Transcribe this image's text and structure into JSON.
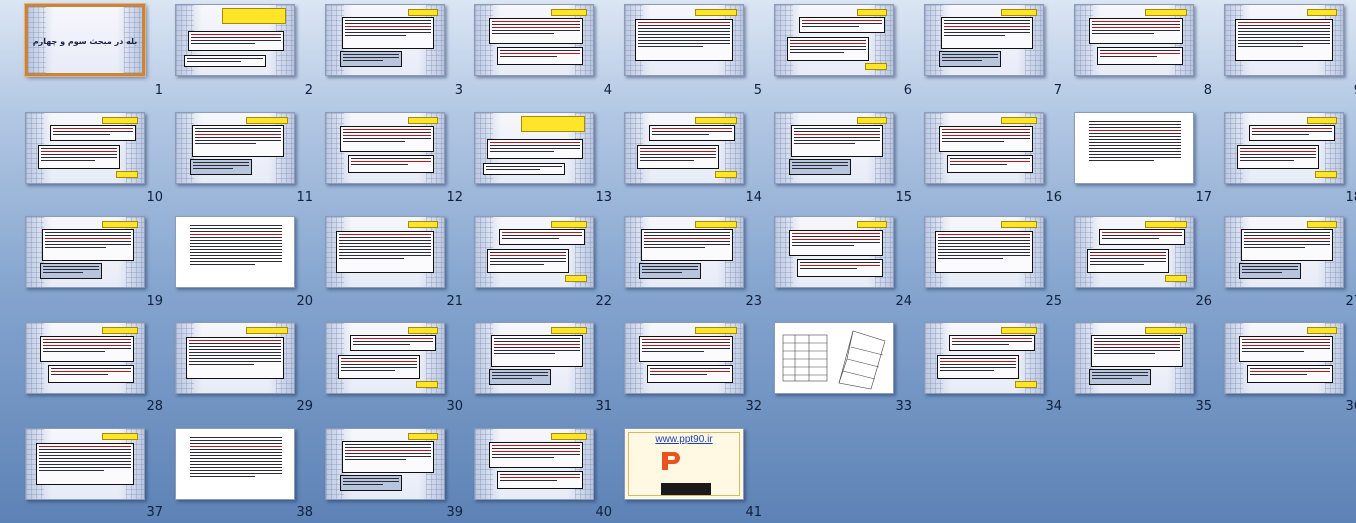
{
  "slide_sorter": {
    "selected_slide": 1,
    "slides": [
      {
        "number": "1",
        "layout": "title",
        "title": "بله در مبحث سوم و چهارم"
      },
      {
        "number": "2",
        "layout": "title-box-yellow"
      },
      {
        "number": "3",
        "layout": "text"
      },
      {
        "number": "4",
        "layout": "text"
      },
      {
        "number": "5",
        "layout": "text"
      },
      {
        "number": "6",
        "layout": "text"
      },
      {
        "number": "7",
        "layout": "text"
      },
      {
        "number": "8",
        "layout": "text"
      },
      {
        "number": "9",
        "layout": "text"
      },
      {
        "number": "10",
        "layout": "text"
      },
      {
        "number": "11",
        "layout": "text"
      },
      {
        "number": "12",
        "layout": "text"
      },
      {
        "number": "13",
        "layout": "title-box-yellow"
      },
      {
        "number": "14",
        "layout": "text"
      },
      {
        "number": "15",
        "layout": "text"
      },
      {
        "number": "16",
        "layout": "text"
      },
      {
        "number": "17",
        "layout": "text-plain"
      },
      {
        "number": "18",
        "layout": "text"
      },
      {
        "number": "19",
        "layout": "text"
      },
      {
        "number": "20",
        "layout": "text-plain"
      },
      {
        "number": "21",
        "layout": "text"
      },
      {
        "number": "22",
        "layout": "text"
      },
      {
        "number": "23",
        "layout": "text"
      },
      {
        "number": "24",
        "layout": "text"
      },
      {
        "number": "25",
        "layout": "text"
      },
      {
        "number": "26",
        "layout": "text"
      },
      {
        "number": "27",
        "layout": "text"
      },
      {
        "number": "28",
        "layout": "text"
      },
      {
        "number": "29",
        "layout": "text"
      },
      {
        "number": "30",
        "layout": "text"
      },
      {
        "number": "31",
        "layout": "text"
      },
      {
        "number": "32",
        "layout": "text"
      },
      {
        "number": "33",
        "layout": "diagram"
      },
      {
        "number": "34",
        "layout": "text"
      },
      {
        "number": "35",
        "layout": "text"
      },
      {
        "number": "36",
        "layout": "text"
      },
      {
        "number": "37",
        "layout": "text"
      },
      {
        "number": "38",
        "layout": "text-plain"
      },
      {
        "number": "39",
        "layout": "text"
      },
      {
        "number": "40",
        "layout": "text"
      },
      {
        "number": "41",
        "layout": "promo",
        "url": "www.ppt90.ir"
      }
    ]
  },
  "colors": {
    "selection_border": "#c9843d",
    "title_highlight": "#ffe52a",
    "link_blue": "#1d3fbf",
    "logo_red": "#e8531f"
  }
}
